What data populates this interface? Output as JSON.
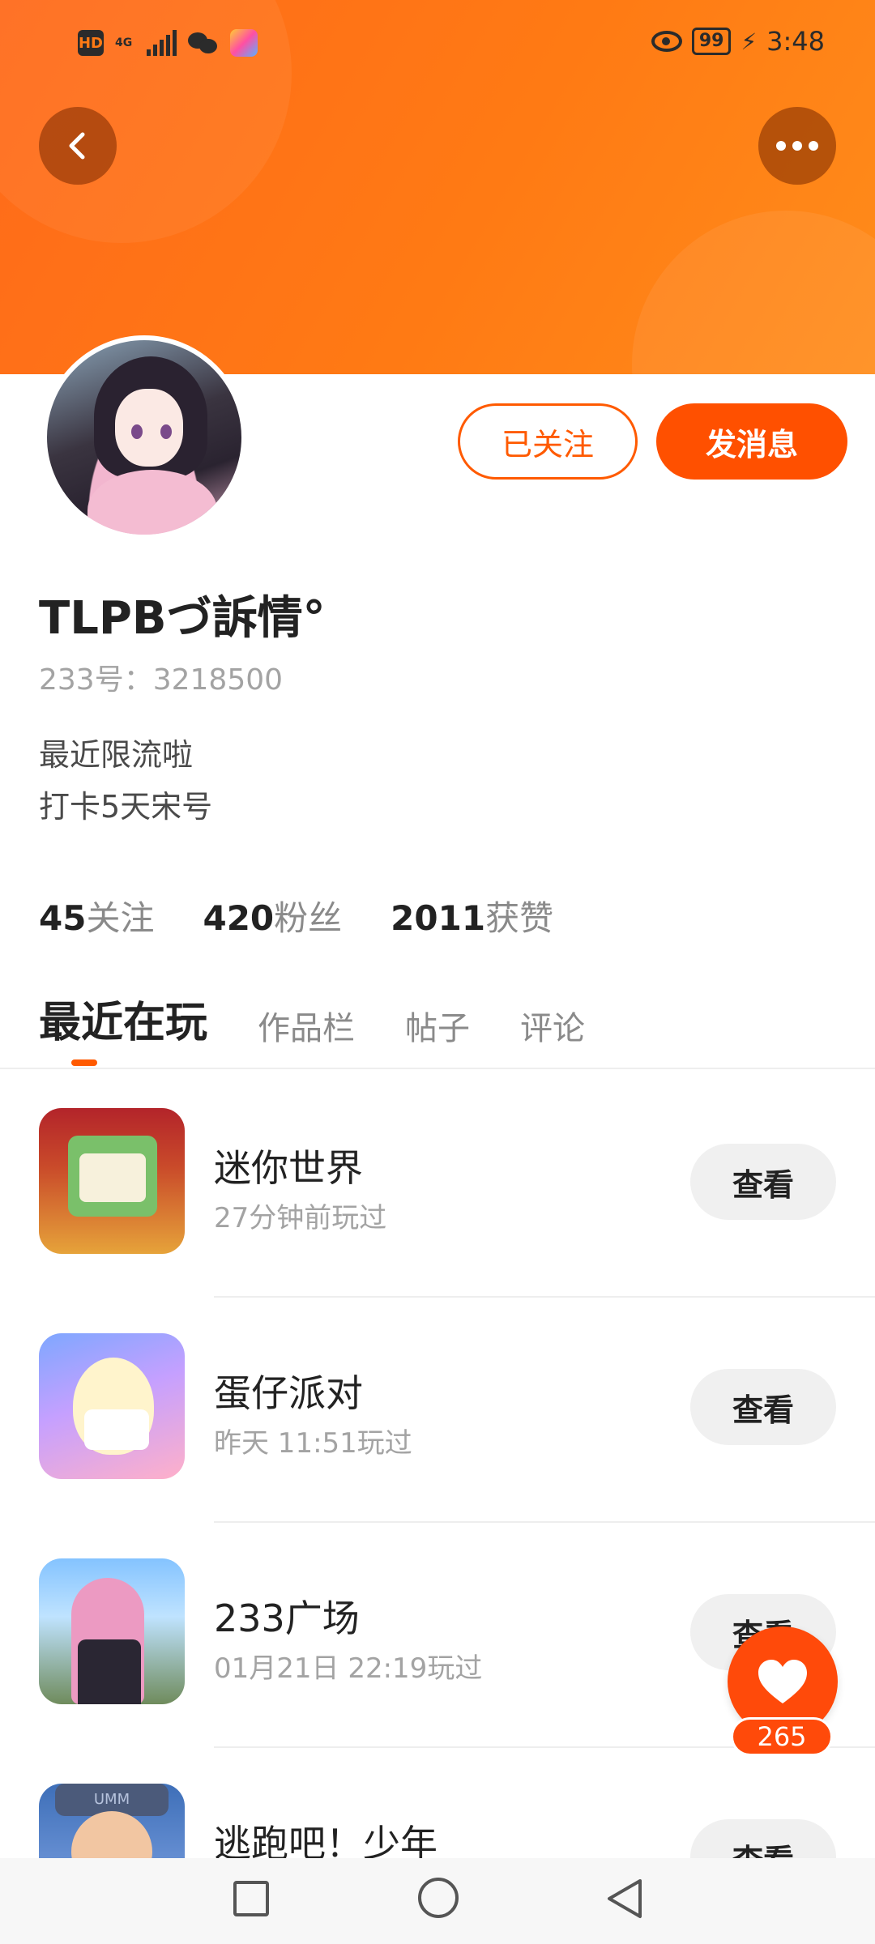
{
  "status_bar": {
    "hd": "HD",
    "network": "4G",
    "battery": "99",
    "time": "3:48"
  },
  "header": {
    "back_icon": "chevron-left-icon",
    "more_icon": "more-dots-icon",
    "banner_color": "#ff7a14"
  },
  "profile": {
    "follow_label": "已关注",
    "message_label": "发消息",
    "name": "TLPBづ訴情°",
    "id_text": "233号：3218500",
    "bio_line1": "最近限流啦",
    "bio_line2": "打卡5天宋号",
    "stats": {
      "following_count": "45",
      "following_label": "关注",
      "fans_count": "420",
      "fans_label": "粉丝",
      "likes_count": "2011",
      "likes_label": "获赞"
    }
  },
  "tabs": [
    {
      "label": "最近在玩"
    },
    {
      "label": "作品栏"
    },
    {
      "label": "帖子"
    },
    {
      "label": "评论"
    }
  ],
  "games": [
    {
      "title": "迷你世界",
      "time": "27分钟前玩过",
      "action": "查看"
    },
    {
      "title": "蛋仔派对",
      "time": "昨天 11:51玩过",
      "action": "查看"
    },
    {
      "title": "233广场",
      "time": "01月21日 22:19玩过",
      "action": "查看"
    },
    {
      "title": "逃跑吧！少年",
      "time": "",
      "action": "查看"
    }
  ],
  "like_fab": {
    "count": "265",
    "icon": "heart-icon"
  },
  "accent_color": "#ff5000"
}
